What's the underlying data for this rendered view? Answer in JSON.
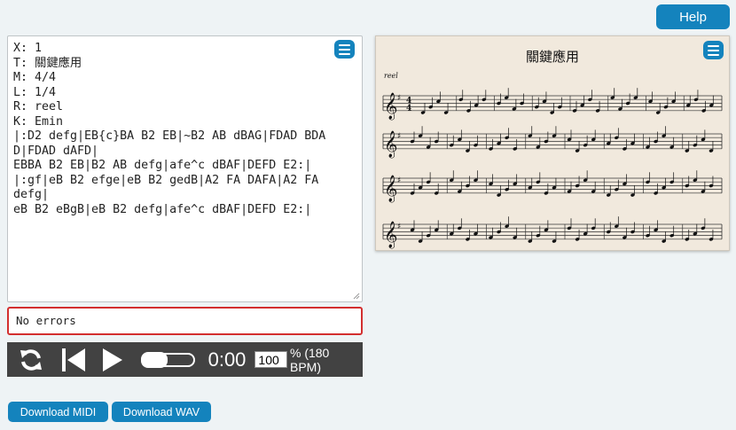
{
  "header": {
    "help_label": "Help"
  },
  "editor": {
    "abc_text": "X: 1\nT: 關鍵應用\nM: 4/4\nL: 1/4\nR: reel\nK: Emin\n|:D2 defg|EB{c}BA B2 EB|~B2 AB dBAG|FDAD BDAD|FDAD dAFD|\nEBBA B2 EB|B2 AB defg|afe^c dBAF|DEFD E2:|\n|:gf|eB B2 efge|eB B2 gedB|A2 FA DAFA|A2 FA defg|\neB B2 eBgB|eB B2 defg|afe^c dBAF|DEFD E2:|"
  },
  "status": {
    "message": "No errors"
  },
  "player": {
    "time": "0:00",
    "tempo_percent": "100",
    "tempo_suffix": "% (180 BPM)",
    "progress": 0
  },
  "downloads": {
    "midi_label": "Download MIDI",
    "wav_label": "Download WAV"
  },
  "score": {
    "title": "關鍵應用",
    "rhythm": "reel"
  },
  "colors": {
    "accent": "#1483bd",
    "error_border": "#d32f2f",
    "player_bg": "#424242",
    "paper": "#f1e9dd"
  }
}
